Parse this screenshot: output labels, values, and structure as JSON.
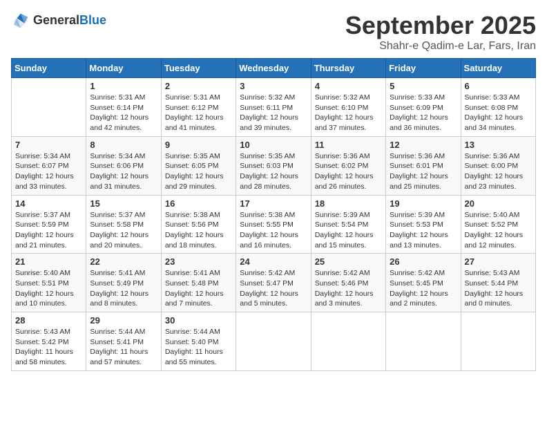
{
  "header": {
    "logo_general": "General",
    "logo_blue": "Blue",
    "month_title": "September 2025",
    "subtitle": "Shahr-e Qadim-e Lar, Fars, Iran"
  },
  "weekdays": [
    "Sunday",
    "Monday",
    "Tuesday",
    "Wednesday",
    "Thursday",
    "Friday",
    "Saturday"
  ],
  "weeks": [
    [
      {
        "day": "",
        "sunrise": "",
        "sunset": "",
        "daylight": ""
      },
      {
        "day": "1",
        "sunrise": "Sunrise: 5:31 AM",
        "sunset": "Sunset: 6:14 PM",
        "daylight": "Daylight: 12 hours and 42 minutes."
      },
      {
        "day": "2",
        "sunrise": "Sunrise: 5:31 AM",
        "sunset": "Sunset: 6:12 PM",
        "daylight": "Daylight: 12 hours and 41 minutes."
      },
      {
        "day": "3",
        "sunrise": "Sunrise: 5:32 AM",
        "sunset": "Sunset: 6:11 PM",
        "daylight": "Daylight: 12 hours and 39 minutes."
      },
      {
        "day": "4",
        "sunrise": "Sunrise: 5:32 AM",
        "sunset": "Sunset: 6:10 PM",
        "daylight": "Daylight: 12 hours and 37 minutes."
      },
      {
        "day": "5",
        "sunrise": "Sunrise: 5:33 AM",
        "sunset": "Sunset: 6:09 PM",
        "daylight": "Daylight: 12 hours and 36 minutes."
      },
      {
        "day": "6",
        "sunrise": "Sunrise: 5:33 AM",
        "sunset": "Sunset: 6:08 PM",
        "daylight": "Daylight: 12 hours and 34 minutes."
      }
    ],
    [
      {
        "day": "7",
        "sunrise": "Sunrise: 5:34 AM",
        "sunset": "Sunset: 6:07 PM",
        "daylight": "Daylight: 12 hours and 33 minutes."
      },
      {
        "day": "8",
        "sunrise": "Sunrise: 5:34 AM",
        "sunset": "Sunset: 6:06 PM",
        "daylight": "Daylight: 12 hours and 31 minutes."
      },
      {
        "day": "9",
        "sunrise": "Sunrise: 5:35 AM",
        "sunset": "Sunset: 6:05 PM",
        "daylight": "Daylight: 12 hours and 29 minutes."
      },
      {
        "day": "10",
        "sunrise": "Sunrise: 5:35 AM",
        "sunset": "Sunset: 6:03 PM",
        "daylight": "Daylight: 12 hours and 28 minutes."
      },
      {
        "day": "11",
        "sunrise": "Sunrise: 5:36 AM",
        "sunset": "Sunset: 6:02 PM",
        "daylight": "Daylight: 12 hours and 26 minutes."
      },
      {
        "day": "12",
        "sunrise": "Sunrise: 5:36 AM",
        "sunset": "Sunset: 6:01 PM",
        "daylight": "Daylight: 12 hours and 25 minutes."
      },
      {
        "day": "13",
        "sunrise": "Sunrise: 5:36 AM",
        "sunset": "Sunset: 6:00 PM",
        "daylight": "Daylight: 12 hours and 23 minutes."
      }
    ],
    [
      {
        "day": "14",
        "sunrise": "Sunrise: 5:37 AM",
        "sunset": "Sunset: 5:59 PM",
        "daylight": "Daylight: 12 hours and 21 minutes."
      },
      {
        "day": "15",
        "sunrise": "Sunrise: 5:37 AM",
        "sunset": "Sunset: 5:58 PM",
        "daylight": "Daylight: 12 hours and 20 minutes."
      },
      {
        "day": "16",
        "sunrise": "Sunrise: 5:38 AM",
        "sunset": "Sunset: 5:56 PM",
        "daylight": "Daylight: 12 hours and 18 minutes."
      },
      {
        "day": "17",
        "sunrise": "Sunrise: 5:38 AM",
        "sunset": "Sunset: 5:55 PM",
        "daylight": "Daylight: 12 hours and 16 minutes."
      },
      {
        "day": "18",
        "sunrise": "Sunrise: 5:39 AM",
        "sunset": "Sunset: 5:54 PM",
        "daylight": "Daylight: 12 hours and 15 minutes."
      },
      {
        "day": "19",
        "sunrise": "Sunrise: 5:39 AM",
        "sunset": "Sunset: 5:53 PM",
        "daylight": "Daylight: 12 hours and 13 minutes."
      },
      {
        "day": "20",
        "sunrise": "Sunrise: 5:40 AM",
        "sunset": "Sunset: 5:52 PM",
        "daylight": "Daylight: 12 hours and 12 minutes."
      }
    ],
    [
      {
        "day": "21",
        "sunrise": "Sunrise: 5:40 AM",
        "sunset": "Sunset: 5:51 PM",
        "daylight": "Daylight: 12 hours and 10 minutes."
      },
      {
        "day": "22",
        "sunrise": "Sunrise: 5:41 AM",
        "sunset": "Sunset: 5:49 PM",
        "daylight": "Daylight: 12 hours and 8 minutes."
      },
      {
        "day": "23",
        "sunrise": "Sunrise: 5:41 AM",
        "sunset": "Sunset: 5:48 PM",
        "daylight": "Daylight: 12 hours and 7 minutes."
      },
      {
        "day": "24",
        "sunrise": "Sunrise: 5:42 AM",
        "sunset": "Sunset: 5:47 PM",
        "daylight": "Daylight: 12 hours and 5 minutes."
      },
      {
        "day": "25",
        "sunrise": "Sunrise: 5:42 AM",
        "sunset": "Sunset: 5:46 PM",
        "daylight": "Daylight: 12 hours and 3 minutes."
      },
      {
        "day": "26",
        "sunrise": "Sunrise: 5:42 AM",
        "sunset": "Sunset: 5:45 PM",
        "daylight": "Daylight: 12 hours and 2 minutes."
      },
      {
        "day": "27",
        "sunrise": "Sunrise: 5:43 AM",
        "sunset": "Sunset: 5:44 PM",
        "daylight": "Daylight: 12 hours and 0 minutes."
      }
    ],
    [
      {
        "day": "28",
        "sunrise": "Sunrise: 5:43 AM",
        "sunset": "Sunset: 5:42 PM",
        "daylight": "Daylight: 11 hours and 58 minutes."
      },
      {
        "day": "29",
        "sunrise": "Sunrise: 5:44 AM",
        "sunset": "Sunset: 5:41 PM",
        "daylight": "Daylight: 11 hours and 57 minutes."
      },
      {
        "day": "30",
        "sunrise": "Sunrise: 5:44 AM",
        "sunset": "Sunset: 5:40 PM",
        "daylight": "Daylight: 11 hours and 55 minutes."
      },
      {
        "day": "",
        "sunrise": "",
        "sunset": "",
        "daylight": ""
      },
      {
        "day": "",
        "sunrise": "",
        "sunset": "",
        "daylight": ""
      },
      {
        "day": "",
        "sunrise": "",
        "sunset": "",
        "daylight": ""
      },
      {
        "day": "",
        "sunrise": "",
        "sunset": "",
        "daylight": ""
      }
    ]
  ]
}
